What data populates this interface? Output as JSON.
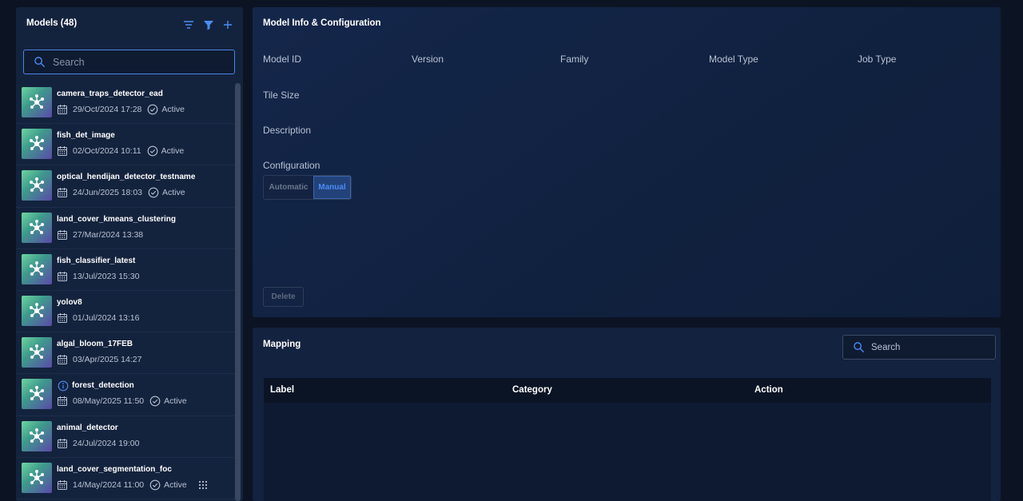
{
  "models_panel": {
    "title": "Models (48)",
    "search_placeholder": "Search",
    "items": [
      {
        "name": "camera_traps_detector_ead",
        "date": "29/Oct/2024 17:28",
        "status": "Active"
      },
      {
        "name": "fish_det_image",
        "date": "02/Oct/2024 10:11",
        "status": "Active"
      },
      {
        "name": "optical_hendijan_detector_testname",
        "date": "24/Jun/2025 18:03",
        "status": "Active"
      },
      {
        "name": "land_cover_kmeans_clustering",
        "date": "27/Mar/2024 13:38"
      },
      {
        "name": "fish_classifier_latest",
        "date": "13/Jul/2023 15:30"
      },
      {
        "name": "yolov8",
        "date": "01/Jul/2024 13:16"
      },
      {
        "name": "algal_bloom_17FEB",
        "date": "03/Apr/2025 14:27"
      },
      {
        "name": "forest_detection",
        "date": "08/May/2025 11:50",
        "status": "Active",
        "info": true
      },
      {
        "name": "animal_detector",
        "date": "24/Jul/2024 19:00"
      },
      {
        "name": "land_cover_segmentation_foc",
        "date": "14/May/2024 11:00",
        "status": "Active",
        "grid": true
      }
    ]
  },
  "info_panel": {
    "title": "Model Info & Configuration",
    "labels": {
      "model_id": "Model ID",
      "version": "Version",
      "family": "Family",
      "model_type": "Model Type",
      "job_type": "Job Type",
      "tile_size": "Tile Size",
      "description": "Description",
      "configuration": "Configuration"
    },
    "config_options": {
      "automatic": "Automatic",
      "manual": "Manual"
    },
    "config_selected": "Manual",
    "delete_label": "Delete"
  },
  "mapping_panel": {
    "title": "Mapping",
    "search_placeholder": "Search",
    "columns": {
      "label": "Label",
      "category": "Category",
      "action": "Action"
    }
  },
  "colors": {
    "accent": "#4b8cf5",
    "background": "#0c1424",
    "panel": "#14233d"
  }
}
